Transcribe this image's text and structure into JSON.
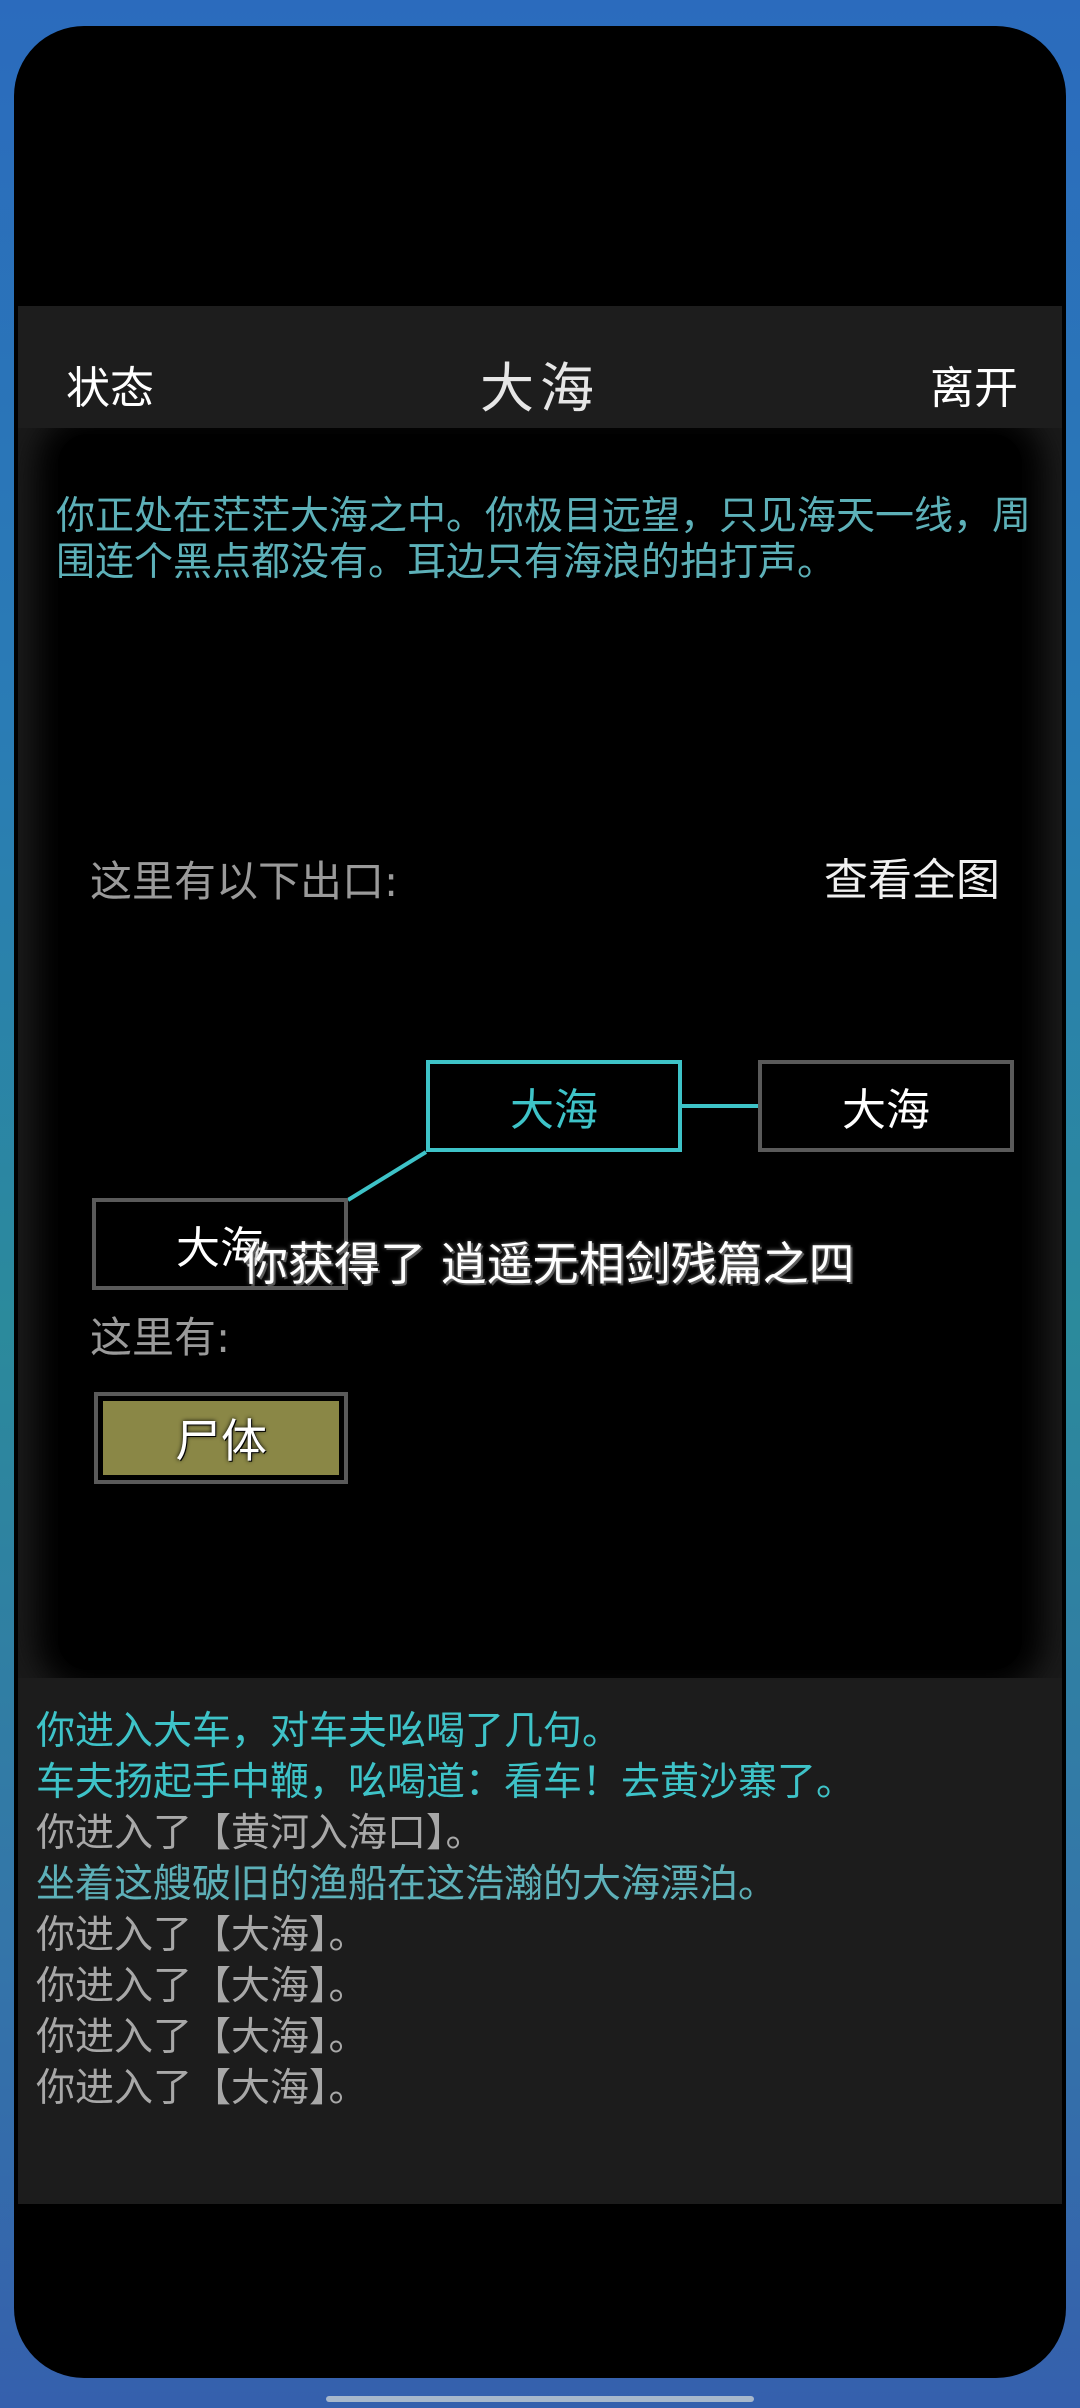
{
  "header": {
    "status_label": "状态",
    "title": "大海",
    "leave_label": "离开"
  },
  "room": {
    "description": "你正处在茫茫大海之中。你极目远望，只见海天一线，周围连个黑点都没有。耳边只有海浪的拍打声。",
    "exits_label": "这里有以下出口:",
    "view_map_label": "查看全图",
    "map": {
      "current": "大海",
      "east": "大海",
      "southwest": "大海"
    },
    "toast": "你获得了 逍遥无相剑残篇之四",
    "here_label": "这里有:",
    "items": [
      "尸体"
    ]
  },
  "log": {
    "lines": [
      {
        "text": "你进入大车，对车夫吆喝了几句。",
        "color": "#3ec3c8"
      },
      {
        "text": "车夫扬起手中鞭，吆喝道：看车！去黄沙寨了。",
        "color": "#3ec3c8"
      },
      {
        "text": "你进入了【黄河入海口】。",
        "color": "#a8a8a8"
      },
      {
        "text": "坐着这艘破旧的渔船在这浩瀚的大海漂泊。",
        "color": "#5db0b8"
      },
      {
        "text": "你进入了【大海】。",
        "color": "#a8a8a8"
      },
      {
        "text": "你进入了【大海】。",
        "color": "#a8a8a8"
      },
      {
        "text": "你进入了【大海】。",
        "color": "#a8a8a8"
      },
      {
        "text": "你进入了【大海】。",
        "color": "#a8a8a8"
      }
    ]
  }
}
